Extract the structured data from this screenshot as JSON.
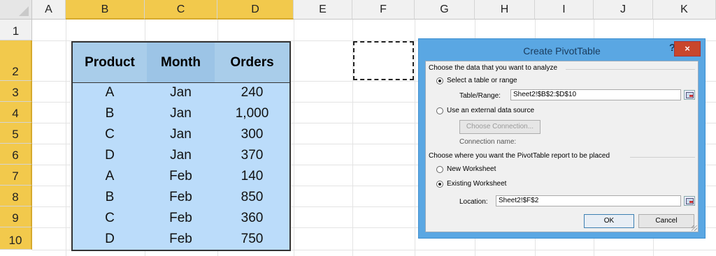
{
  "columns": [
    "A",
    "B",
    "C",
    "D",
    "E",
    "F",
    "G",
    "H",
    "I",
    "J",
    "K"
  ],
  "rows": [
    "1",
    "2",
    "3",
    "4",
    "5",
    "6",
    "7",
    "8",
    "9",
    "10"
  ],
  "table": {
    "headers": [
      "Product",
      "Month",
      "Orders"
    ],
    "rows": [
      [
        "A",
        "Jan",
        "240"
      ],
      [
        "B",
        "Jan",
        "1,000"
      ],
      [
        "C",
        "Jan",
        "300"
      ],
      [
        "D",
        "Jan",
        "370"
      ],
      [
        "A",
        "Feb",
        "140"
      ],
      [
        "B",
        "Feb",
        "850"
      ],
      [
        "C",
        "Feb",
        "360"
      ],
      [
        "D",
        "Feb",
        "750"
      ]
    ]
  },
  "dialog": {
    "title": "Create PivotTable",
    "help": "?",
    "close": "×",
    "section1": "Choose the data that you want to analyze",
    "opt_table": "Select a table or range",
    "range_label": "Table/Range:",
    "range_value": "Sheet2!$B$2:$D$10",
    "opt_external": "Use an external data source",
    "choose_connection": "Choose Connection...",
    "connection_name": "Connection name:",
    "section2": "Choose where you want the PivotTable report to be placed",
    "opt_new": "New Worksheet",
    "opt_existing": "Existing Worksheet",
    "location_label": "Location:",
    "location_value": "Sheet2!$F$2",
    "ok": "OK",
    "cancel": "Cancel"
  },
  "colors": {
    "selected_header": "#f2c94c",
    "table_fill": "#bbdcfa",
    "dialog_frame": "#5aa7e3",
    "close_button": "#c9462c"
  }
}
